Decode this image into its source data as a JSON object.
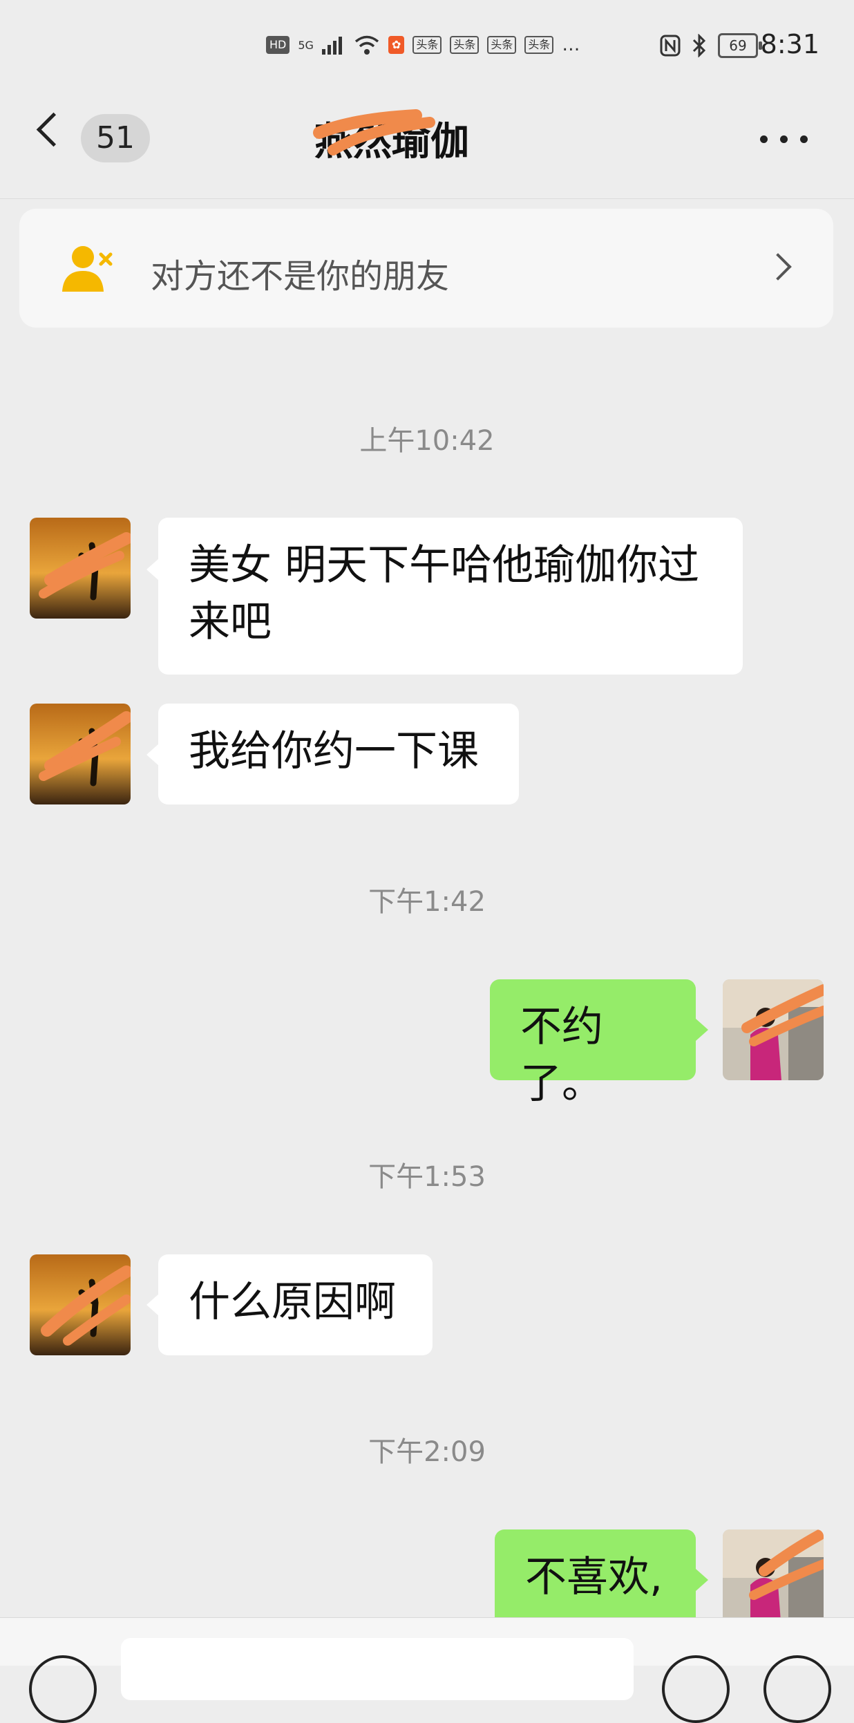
{
  "status_bar": {
    "icons_left": [
      "HD",
      "5G",
      "signal-bars",
      "wifi",
      "app-notification",
      "头条",
      "头条",
      "头条",
      "头条",
      "…"
    ],
    "icons_right": [
      "nfc-icon",
      "bluetooth-icon"
    ],
    "battery": "69",
    "time": "8:31"
  },
  "header": {
    "unread_count": "51",
    "title": "燕然瑜伽"
  },
  "notice": {
    "text": "对方还不是你的朋友"
  },
  "messages": [
    {
      "type": "time",
      "text": "上午10:42"
    },
    {
      "type": "in",
      "text": "美女 明天下午哈他瑜伽你过来吧"
    },
    {
      "type": "in",
      "text": "我给你约一下课"
    },
    {
      "type": "time",
      "text": "下午1:42"
    },
    {
      "type": "out",
      "text": "不约了。"
    },
    {
      "type": "time",
      "text": "下午1:53"
    },
    {
      "type": "in",
      "text": "什么原因啊"
    },
    {
      "type": "time",
      "text": "下午2:09"
    },
    {
      "type": "out",
      "text": "不喜欢,"
    }
  ],
  "colors": {
    "background": "#ededed",
    "outgoing_bubble": "#95ec69",
    "incoming_bubble": "#ffffff",
    "redaction": "#f08a4b"
  }
}
